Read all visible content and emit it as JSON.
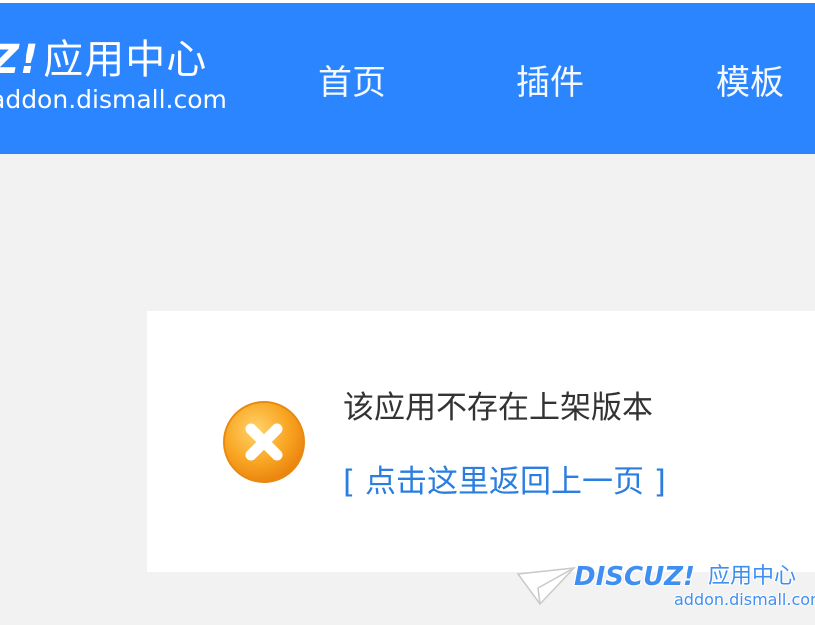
{
  "header": {
    "logo_mark": "Z!",
    "logo_title": "应用中心",
    "logo_domain": "addon.dismall.com",
    "nav": [
      {
        "label": "首页"
      },
      {
        "label": "插件"
      },
      {
        "label": "模板"
      }
    ]
  },
  "message": {
    "icon": "error-icon",
    "text": "该应用不存在上架版本",
    "back_link": "[ 点击这里返回上一页 ]"
  },
  "watermark": {
    "brand": "DISCUZ!",
    "title": "应用中心",
    "domain": "addon.dismall.com"
  },
  "colors": {
    "header_bg": "#2a85ff",
    "page_bg": "#f2f2f2",
    "link": "#2a7de1",
    "error_icon": "#f7a21b"
  }
}
